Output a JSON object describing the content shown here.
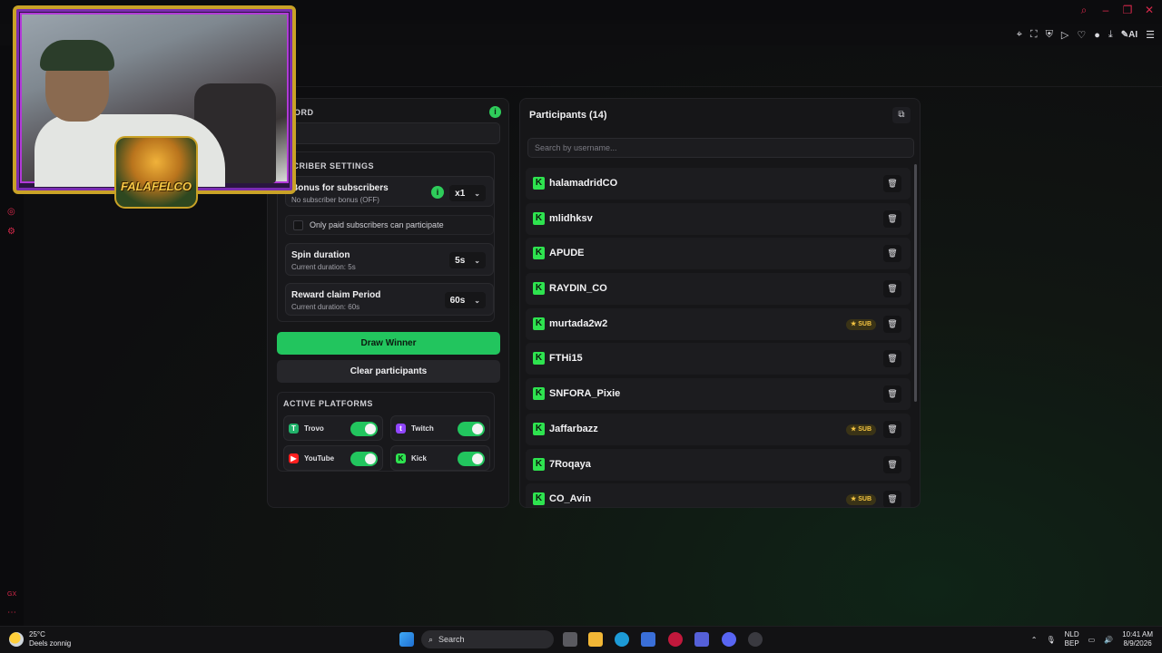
{
  "settings": {
    "keyword_title": "WORD",
    "subscriber_title": "SCRIBER SETTINGS",
    "bonus": {
      "title": "Bonus for subscribers",
      "subtitle": "No subscriber bonus (OFF)",
      "value": "x1"
    },
    "paid_only_label": "Only paid subscribers can participate",
    "spin": {
      "title": "Spin duration",
      "subtitle": "Current duration: 5s",
      "value": "5s"
    },
    "reward": {
      "title": "Reward claim Period",
      "subtitle": "Current duration: 60s",
      "value": "60s"
    },
    "draw_label": "Draw Winner",
    "clear_label": "Clear participants"
  },
  "platforms": {
    "title": "ACTIVE PLATFORMS",
    "items": [
      "Trovo",
      "Twitch",
      "YouTube",
      "Kick"
    ]
  },
  "participants": {
    "title": "Participants (14)",
    "search_placeholder": "Search by username...",
    "sub_badge": "SUB",
    "rows": [
      {
        "name": "halamadridCO",
        "sub": false
      },
      {
        "name": "mlidhksv",
        "sub": false
      },
      {
        "name": "APUDE",
        "sub": false
      },
      {
        "name": "RAYDIN_CO",
        "sub": false
      },
      {
        "name": "murtada2w2",
        "sub": true
      },
      {
        "name": "FTHi15",
        "sub": false
      },
      {
        "name": "SNFORA_Pixie",
        "sub": false
      },
      {
        "name": "Jaffarbazz",
        "sub": true
      },
      {
        "name": "7Roqaya",
        "sub": false
      },
      {
        "name": "CO_Avin",
        "sub": true
      }
    ]
  },
  "webcam": {
    "logo_text": "FALAFELCO"
  },
  "taskbar": {
    "weather_temp": "25°C",
    "weather_desc": "Deels zonnig",
    "search_label": "Search",
    "lang_top": "NLD",
    "lang_bottom": "BEP",
    "time": "10:41 AM",
    "date": "8/9/2026"
  },
  "colors": {
    "accent": "#22c55e",
    "sub_badge": "#f5c542",
    "chrome_accent": "#d6284a"
  }
}
